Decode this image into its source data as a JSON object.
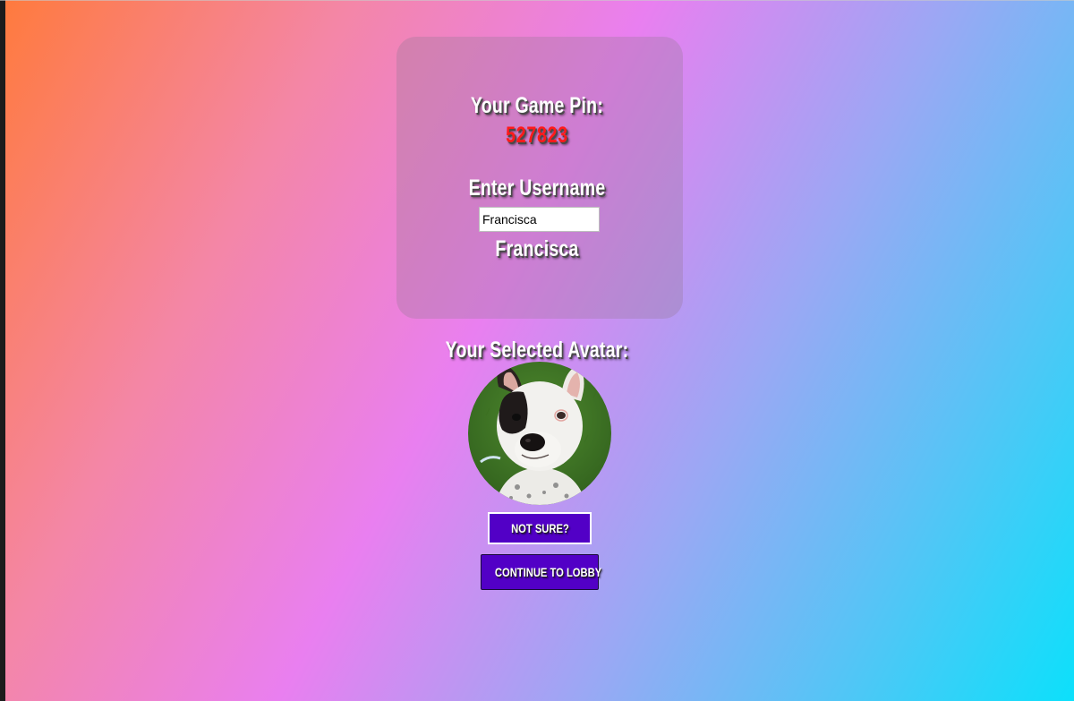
{
  "game": {
    "pin_label": "Your Game Pin:",
    "pin_value": "527823"
  },
  "user": {
    "label": "Enter Username",
    "input_value": "Francisca",
    "display_name": "Francisca"
  },
  "avatar": {
    "label": "Your Selected Avatar:",
    "subject": "dog-photo"
  },
  "buttons": {
    "not_sure": "NOT SURE?",
    "continue": "CONTINUE TO LOBBY"
  },
  "colors": {
    "pin": "#ff1a1a",
    "button": "#5200c6",
    "gradient_start": "#ff7a3c",
    "gradient_mid": "#e97ff0",
    "gradient_end": "#0ce0fb"
  }
}
